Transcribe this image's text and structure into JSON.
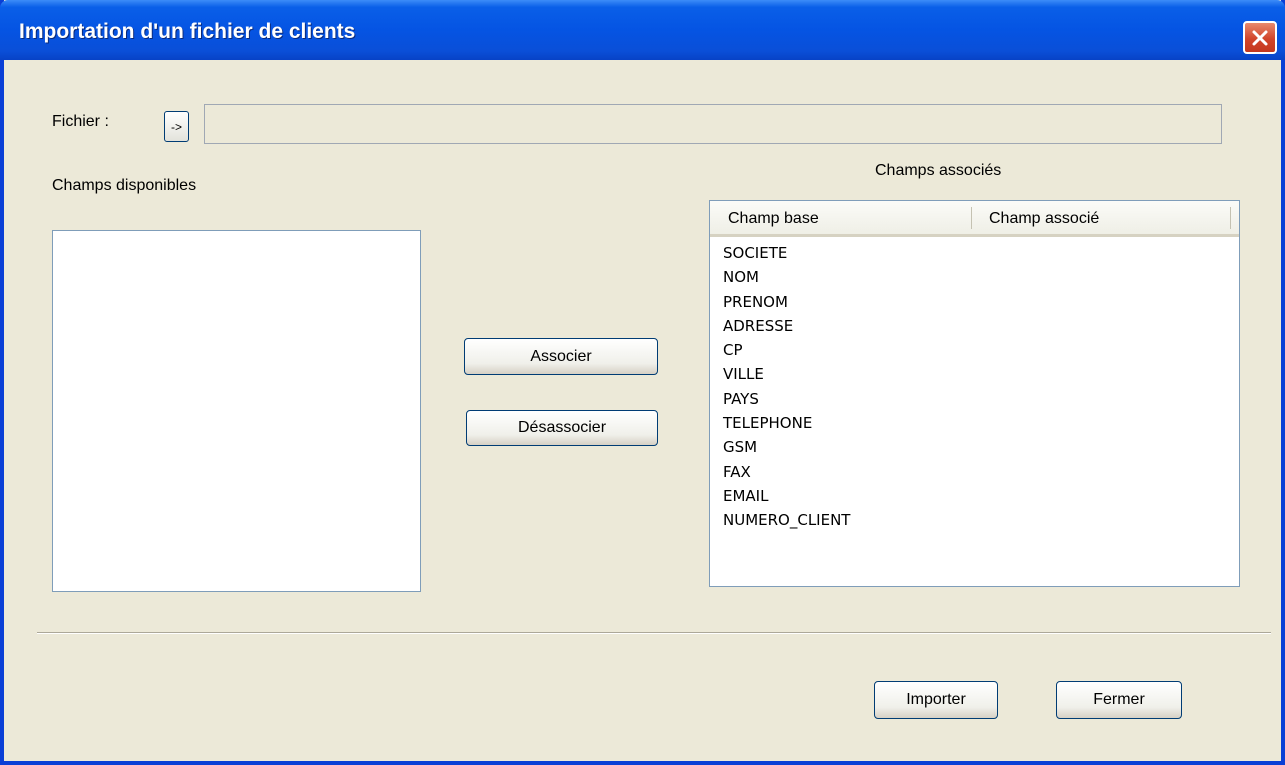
{
  "window": {
    "title": "Importation d'un fichier de clients"
  },
  "file": {
    "label": "Fichier :",
    "browse_label": "->",
    "path_value": ""
  },
  "available": {
    "label": "Champs disponibles",
    "items": []
  },
  "actions": {
    "associate_label": "Associer",
    "dissociate_label": "Désassocier"
  },
  "associated": {
    "label": "Champs associés",
    "columns": [
      "Champ base",
      "Champ associé"
    ],
    "rows": [
      "SOCIETE",
      "NOM",
      "PRENOM",
      "ADRESSE",
      "CP",
      "VILLE",
      "PAYS",
      "TELEPHONE",
      "GSM",
      "FAX",
      "EMAIL",
      "NUMERO_CLIENT"
    ]
  },
  "footer": {
    "import_label": "Importer",
    "close_label": "Fermer"
  },
  "colors": {
    "titlebar": "#0554e3",
    "window_bg": "#ece9d8",
    "close_button": "#d2452b",
    "button_border": "#003c74"
  },
  "icons": {
    "close": "close-icon"
  }
}
